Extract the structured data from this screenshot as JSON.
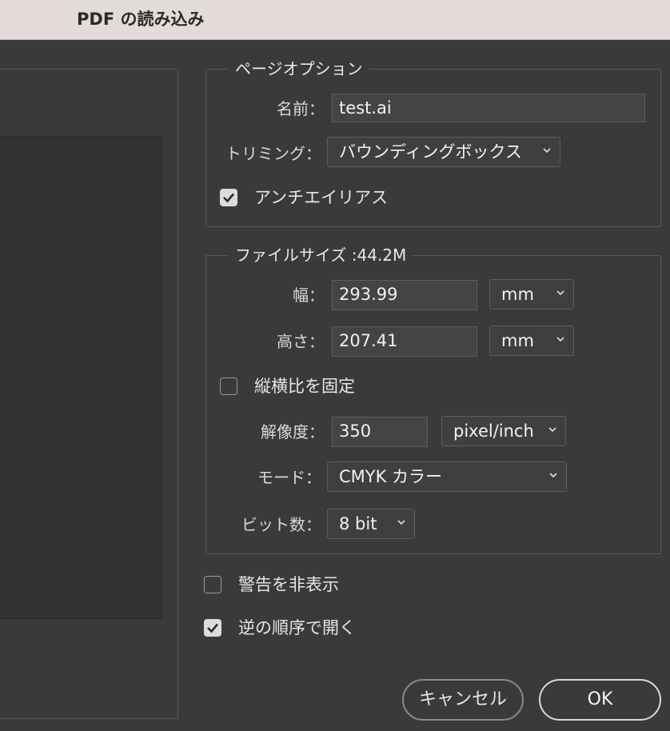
{
  "window": {
    "title": "PDF の読み込み"
  },
  "page_options": {
    "legend": "ページオプション",
    "name_label": "名前：",
    "name_value": "test.ai",
    "trim_label": "トリミング：",
    "trim_value": "バウンディングボックス",
    "antialias_label": "アンチエイリアス",
    "antialias_checked": true
  },
  "file_size": {
    "legend": "ファイルサイズ :44.2M",
    "width_label": "幅：",
    "width_value": "293.99",
    "width_unit": "mm",
    "height_label": "高さ：",
    "height_value": "207.41",
    "height_unit": "mm",
    "constrain_label": "縦横比を固定",
    "constrain_checked": false,
    "resolution_label": "解像度：",
    "resolution_value": "350",
    "resolution_unit": "pixel/inch",
    "mode_label": "モード：",
    "mode_value": "CMYK カラー",
    "bits_label": "ビット数：",
    "bits_value": "8 bit"
  },
  "options": {
    "suppress_warnings_label": "警告を非表示",
    "suppress_warnings_checked": false,
    "reverse_order_label": "逆の順序で開く",
    "reverse_order_checked": true
  },
  "buttons": {
    "cancel": "キャンセル",
    "ok": "OK"
  },
  "icons": {
    "dropdown": "chevron-down-icon",
    "check": "checkmark-icon"
  },
  "colors": {
    "titlebar": "#e3dada",
    "panel": "#3a3a3a",
    "field": "#444444"
  }
}
